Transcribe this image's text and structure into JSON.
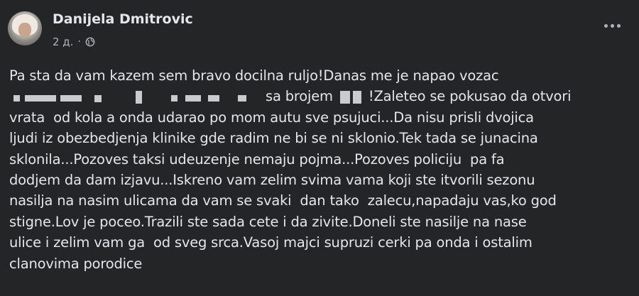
{
  "post": {
    "author": "Danijela Dmitrovic",
    "time": "2 д.",
    "separator": "·",
    "privacy_icon": "globe-icon",
    "more_icon": "more-options-icon",
    "lines": [
      "Pa sta da vam kazem sem bravo docilna ruljo!Danas me je napao vozac",
      "sa brojem",
      "!Zaleteo se pokusao da otvori",
      "vrata  od kola a onda udarao po mom autu sve psujuci...Da nisu prisli dvojica",
      "ljudi iz obezbedjenja klinike gde radim ne bi se ni sklonio.Tek tada se junacina",
      "sklonila...Pozoves taksi udeuzenje nemaju pojma...Pozoves policiju  pa fa",
      "dodjem da dam izjavu...Iskreno vam zelim svima vama koji ste itvorili sezonu",
      "nasilja na nasim ulicama da vam se svaki  dan tako  zalecu,napadaju vas,ko god",
      "stigne.Lov je poceo.Trazili ste sada cete i da zivite.Doneli ste nasilje na nase",
      "ulice i zelim vam ga  od sveg srca.Vasoj majci supruzi cerki pa onda i ostalim",
      "clanovima porodice"
    ]
  }
}
